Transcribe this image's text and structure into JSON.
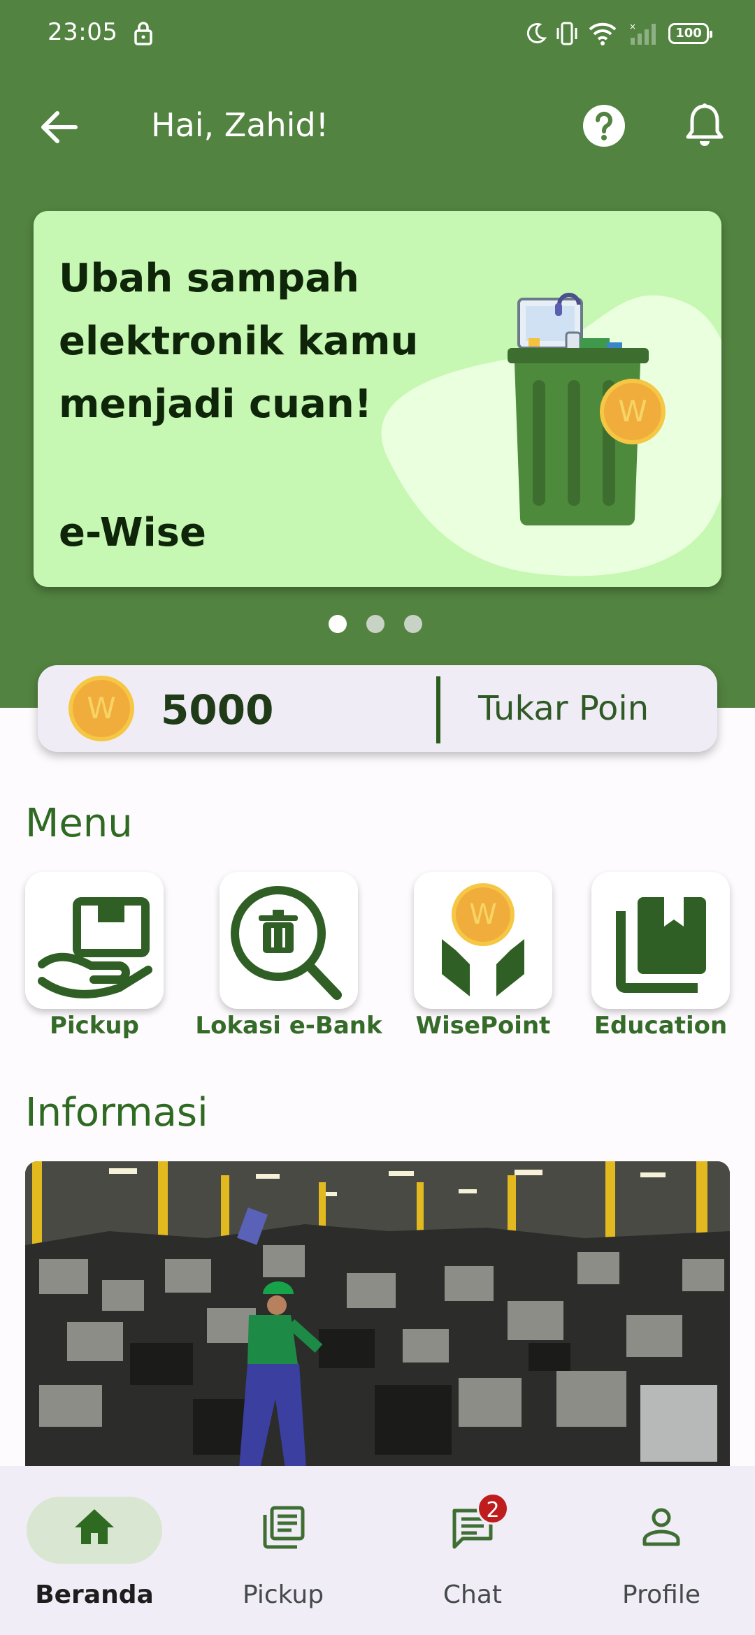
{
  "status_bar": {
    "time": "23:05",
    "battery": "100"
  },
  "app_bar": {
    "greeting": "Hai, Zahid!"
  },
  "banner": {
    "headline": "Ubah sampah elektronik kamu menjadi cuan!",
    "brand": "e-Wise",
    "coin_letter": "W",
    "carousel_total": 3,
    "carousel_active_index": 0
  },
  "points": {
    "coin_letter": "W",
    "value": "5000",
    "redeem_label": "Tukar Poin"
  },
  "menu": {
    "title": "Menu",
    "items": [
      {
        "label": "Pickup",
        "icon": "hand-box-icon"
      },
      {
        "label": "Lokasi e-Bank",
        "icon": "search-trash-icon"
      },
      {
        "label": "WisePoint",
        "icon": "hands-coin-icon"
      },
      {
        "label": "Education",
        "icon": "books-icon"
      }
    ],
    "wisepoint_coin_letter": "W"
  },
  "info": {
    "title": "Informasi"
  },
  "bottom_nav": {
    "items": [
      {
        "label": "Beranda",
        "icon": "home-icon",
        "active": true
      },
      {
        "label": "Pickup",
        "icon": "document-list-icon",
        "active": false
      },
      {
        "label": "Chat",
        "icon": "chat-icon",
        "active": false,
        "badge": "2"
      },
      {
        "label": "Profile",
        "icon": "person-icon",
        "active": false
      }
    ]
  },
  "colors": {
    "primary": "#528340",
    "banner_bg": "#c7f8b3",
    "accent_text": "#2f6a22",
    "coin": "#f1ad3c",
    "badge": "#bf1d1d"
  }
}
